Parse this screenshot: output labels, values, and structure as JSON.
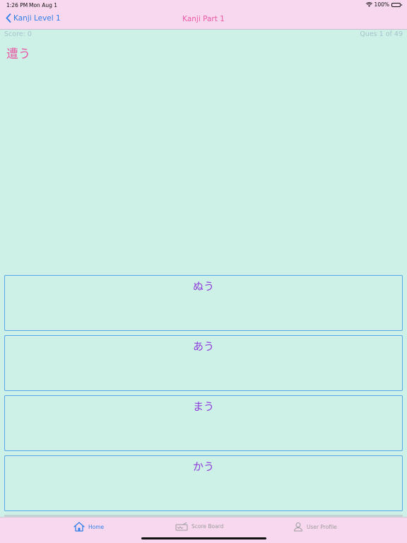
{
  "status_bar": {
    "time": "1:26 PM",
    "date": "Mon Aug 1",
    "battery": "100%"
  },
  "nav": {
    "back_label": "Kanji Level 1",
    "title": "Kanji Part 1"
  },
  "quiz": {
    "score": "Score: 0",
    "counter": "Ques 1 of 49",
    "question": "遭う",
    "options": [
      "ぬう",
      "あう",
      "まう",
      "かう"
    ]
  },
  "tabs": [
    {
      "label": "Home",
      "icon": "home-icon",
      "active": true
    },
    {
      "label": "Score Board",
      "icon": "scoreboard-icon",
      "active": false
    },
    {
      "label": "User Profile",
      "icon": "user-icon",
      "active": false
    }
  ],
  "colors": {
    "background": "#cdf0e7",
    "bars": "#f8d8ee",
    "accent_blue": "#2f7ee9",
    "accent_pink": "#ea5aa5",
    "option_text": "#8f3fdc"
  }
}
